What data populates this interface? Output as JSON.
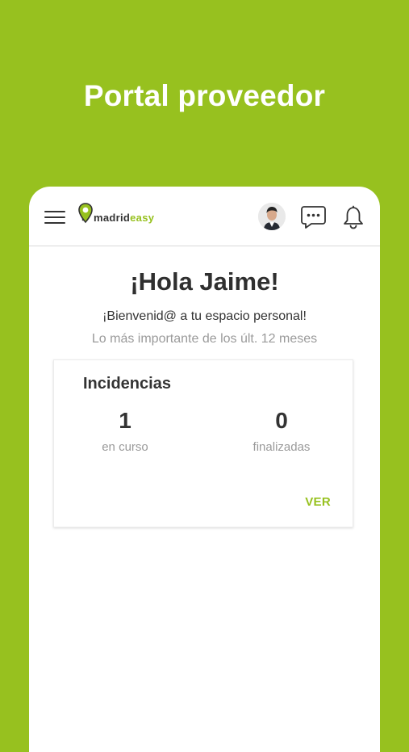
{
  "hero": {
    "title": "Portal proveedor"
  },
  "app_bar": {
    "logo_text_primary": "madrid",
    "logo_text_accent": "easy",
    "icons": {
      "menu": "hamburger-menu-icon",
      "avatar": "user-avatar",
      "messages": "chat-bubble-icon",
      "notifications": "bell-icon"
    }
  },
  "main": {
    "greeting": "¡Hola Jaime!",
    "welcome": "¡Bienvenid@ a tu espacio personal!",
    "period_note": "Lo más importante de los últ. 12 meses"
  },
  "incidents_card": {
    "title": "Incidencias",
    "stats": [
      {
        "value": "1",
        "label": "en curso"
      },
      {
        "value": "0",
        "label": "finalizadas"
      }
    ],
    "action_label": "VER"
  },
  "colors": {
    "brand_green": "#97c11f",
    "text_dark": "#333333",
    "text_muted": "#9a9a9a",
    "background_white": "#ffffff"
  }
}
